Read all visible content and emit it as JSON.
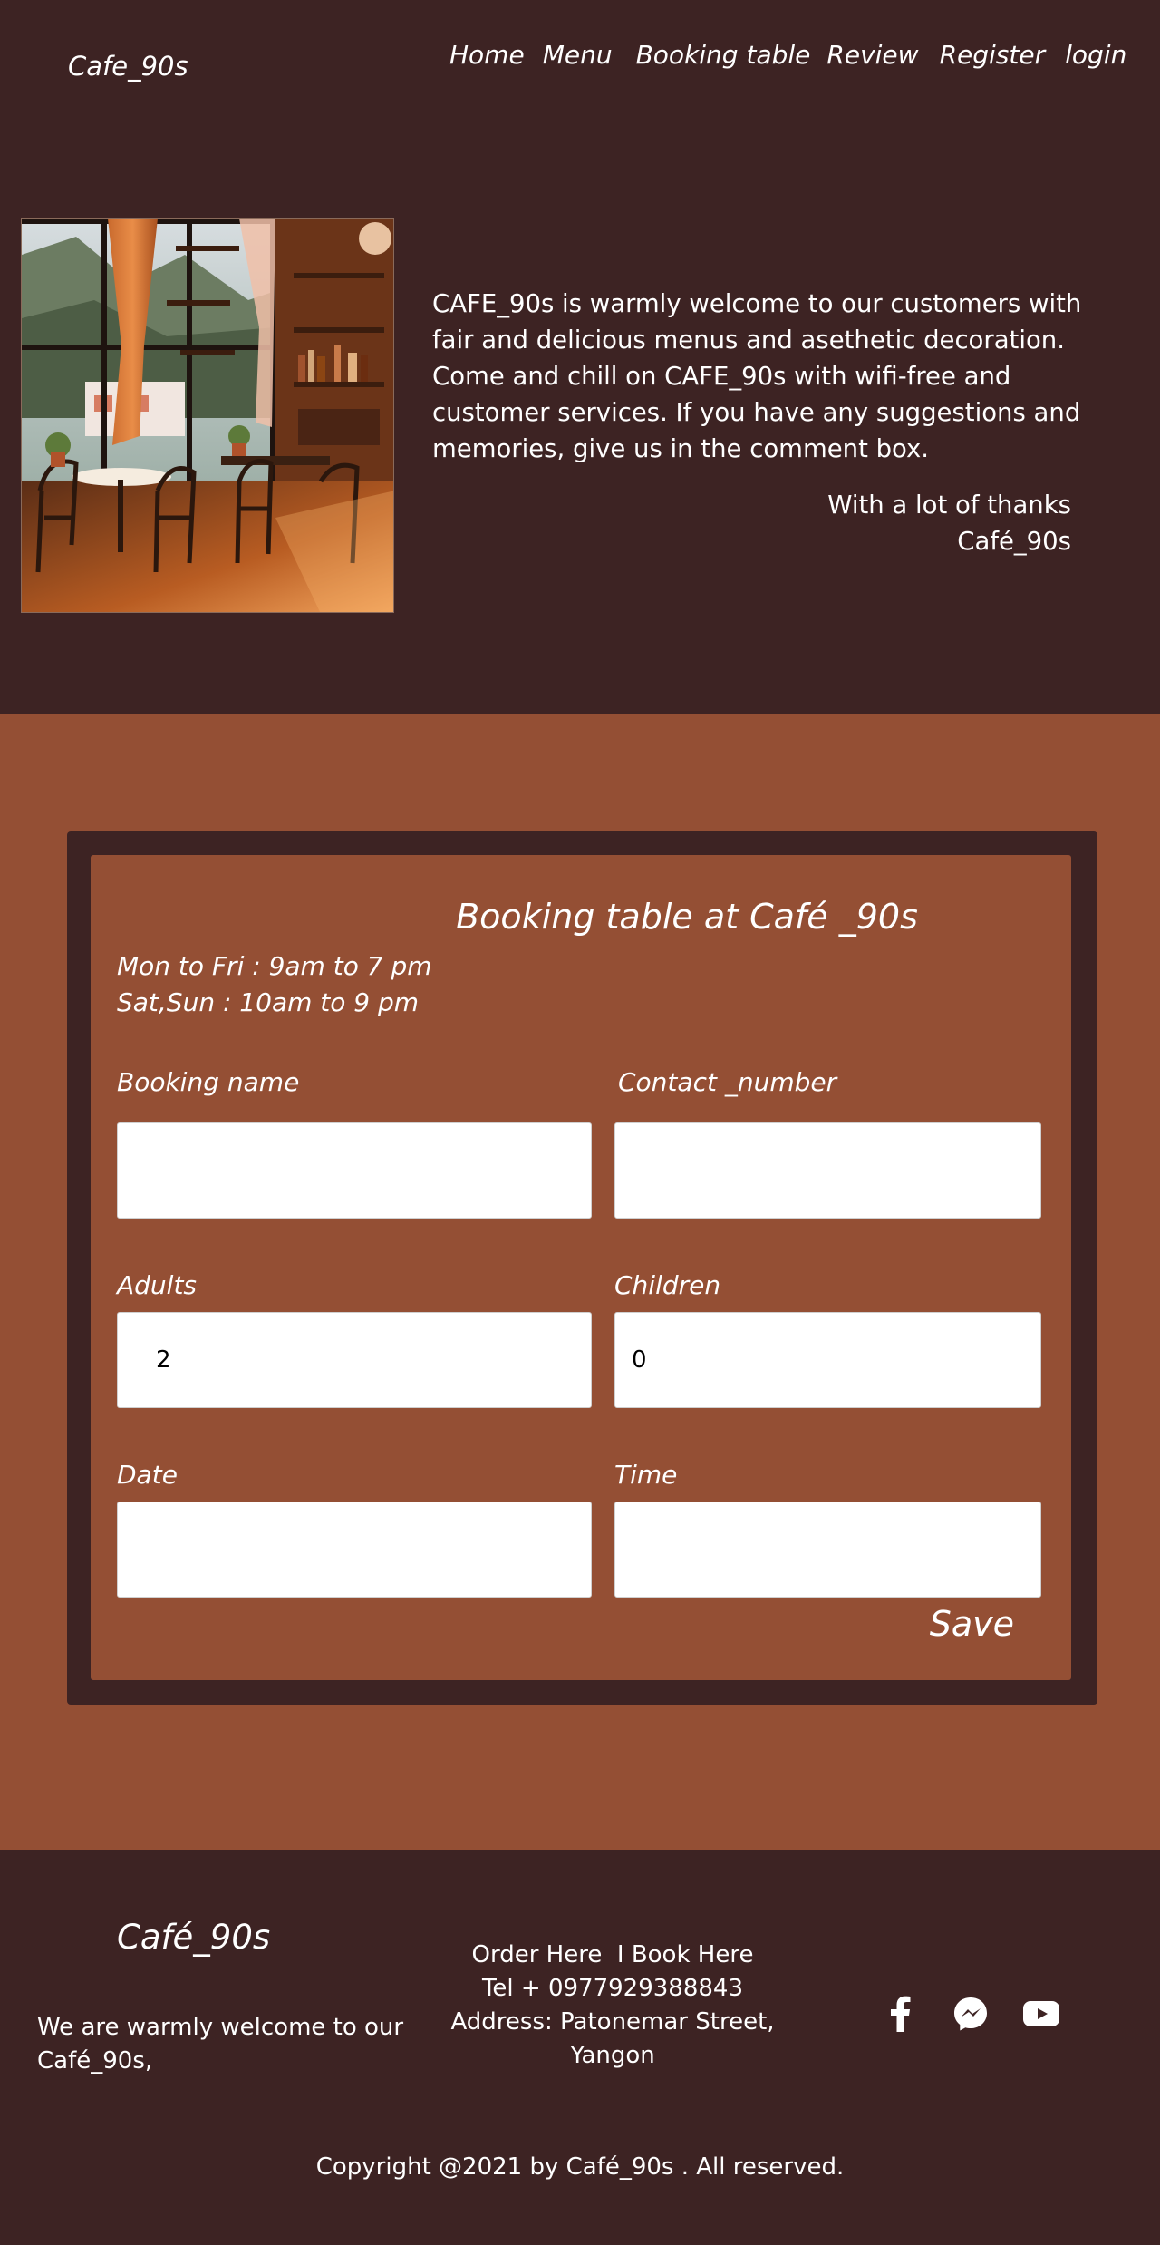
{
  "header": {
    "brand": "Cafe_90s",
    "nav": [
      "Home",
      "Menu",
      "Booking table",
      "Review",
      "Register",
      "login"
    ]
  },
  "hero": {
    "image_alt": "cafe interior with wooden chairs, bookshelves and large windows",
    "description": "CAFE_90s is warmly welcome to our customers with fair and delicious menus and asethetic decoration. Come and chill on CAFE_90s with wifi-free and customer services. If you have any suggestions and memories, give us in the comment box.",
    "thanks_line1": "With a lot of thanks",
    "thanks_line2": "Café_90s"
  },
  "booking": {
    "title": "Booking table at Café _90s",
    "hours_weekday": "Mon to Fri : 9am to 7 pm",
    "hours_weekend": "Sat,Sun : 10am to 9 pm",
    "fields": {
      "name_label": "Booking name",
      "name_value": "",
      "contact_label": "Contact _number",
      "contact_value": "",
      "adults_label": "Adults",
      "adults_value": "2",
      "children_label": "Children",
      "children_value": "0",
      "date_label": "Date",
      "date_value": "",
      "time_label": "Time",
      "time_value": ""
    },
    "save_label": "Save"
  },
  "footer": {
    "brand": "Café_90s",
    "about": "We are warmly welcome to our Café_90s,",
    "order_link": "Order Here",
    "separator": "I",
    "book_link": "Book Here",
    "tel": "Tel + 0977929388843",
    "address": "Address: Patonemar Street, Yangon",
    "socials": [
      "facebook-icon",
      "messenger-icon",
      "youtube-icon"
    ],
    "copyright": "Copyright @2021 by Café_90s . All reserved."
  },
  "colors": {
    "dark": "#3d2323",
    "rust": "#944f34",
    "text": "#ffffff"
  }
}
